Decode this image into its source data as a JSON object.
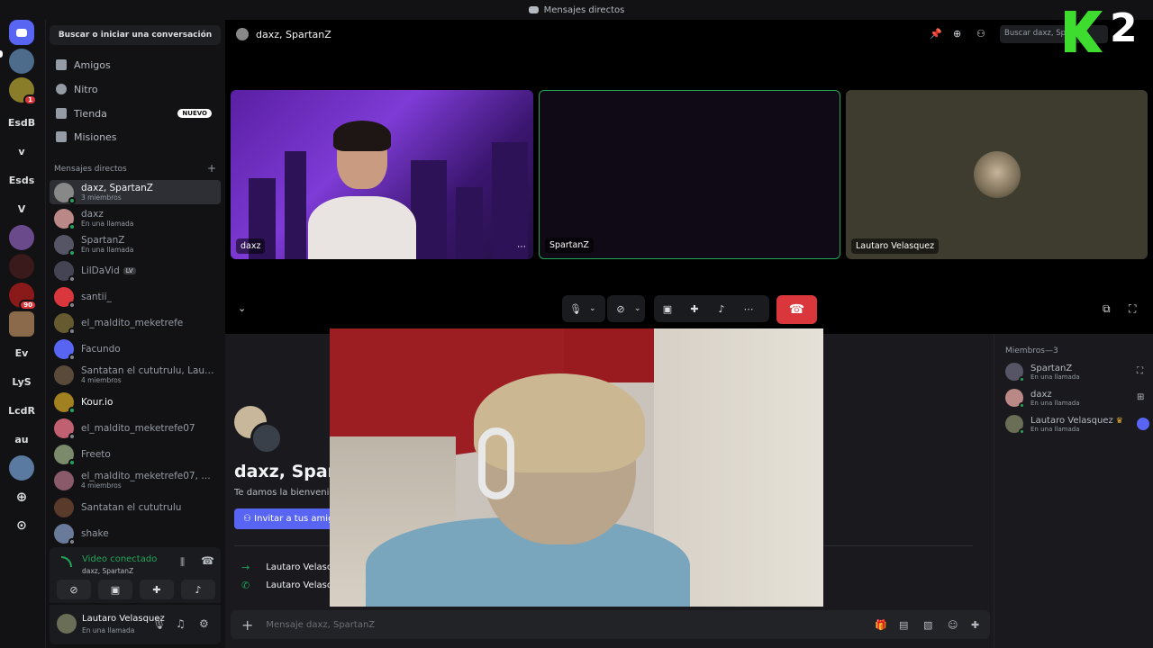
{
  "titlebar": {
    "title": "Mensajes directos"
  },
  "servers": {
    "items": [
      "EsdB",
      "v",
      "Esds",
      "V",
      "Ev",
      "LyS",
      "LcdR",
      "au"
    ],
    "badges": [
      "1",
      "90"
    ]
  },
  "dm": {
    "search_label": "Buscar o iniciar una conversación",
    "nav": [
      {
        "label": "Amigos"
      },
      {
        "label": "Nitro"
      },
      {
        "label": "Tienda",
        "badge": "NUEVO"
      },
      {
        "label": "Misiones"
      }
    ],
    "section_title": "Mensajes directos",
    "list": [
      {
        "name": "daxz, SpartanZ",
        "sub": "3 miembros"
      },
      {
        "name": "daxz",
        "sub": "En una llamada"
      },
      {
        "name": "SpartanZ",
        "sub": "En una llamada"
      },
      {
        "name": "LilDaVid",
        "tag": "LV"
      },
      {
        "name": "santii_"
      },
      {
        "name": "el_maldito_meketrefe"
      },
      {
        "name": "Facundo"
      },
      {
        "name": "Santatan el cututrulu, Lautari...",
        "sub": "4 miembros"
      },
      {
        "name": "Kour.io"
      },
      {
        "name": "el_maldito_meketrefe07"
      },
      {
        "name": "Freeto"
      },
      {
        "name": "el_maldito_meketrefe07, Cat...",
        "sub": "4 miembros"
      },
      {
        "name": "Santatan el cututrulu"
      },
      {
        "name": "shake"
      }
    ]
  },
  "voice": {
    "status": "Video conectado",
    "channel": "daxz, SpartanZ"
  },
  "user": {
    "name": "Lautaro Velasquez",
    "status": "En una llamada"
  },
  "header": {
    "title": "daxz, SpartanZ",
    "search_placeholder": "Buscar daxz, Spartan"
  },
  "tiles": [
    {
      "label": "daxz"
    },
    {
      "label": "SpartanZ"
    },
    {
      "label": "Lautaro Velasquez"
    }
  ],
  "chat": {
    "title": "daxz, Spart",
    "welcome": "Te damos la bienvenida",
    "invite_label": "Invitar a tus amig",
    "system_messages": [
      "Lautaro Velasc",
      "Lautaro Velasc"
    ],
    "input_placeholder": "Mensaje daxz, SpartanZ"
  },
  "members": {
    "title": "Miembros—3",
    "list": [
      {
        "name": "SpartanZ",
        "sub": "En una llamada"
      },
      {
        "name": "daxz",
        "sub": "En una llamada"
      },
      {
        "name": "Lautaro Velasquez",
        "sub": "En una llamada"
      }
    ]
  },
  "overlay_logo": {
    "letter": "K",
    "digit": "2",
    "color": "#3ddc2e"
  },
  "colors": {
    "accent": "#5865f2",
    "online": "#23a55a",
    "danger": "#da373c"
  }
}
